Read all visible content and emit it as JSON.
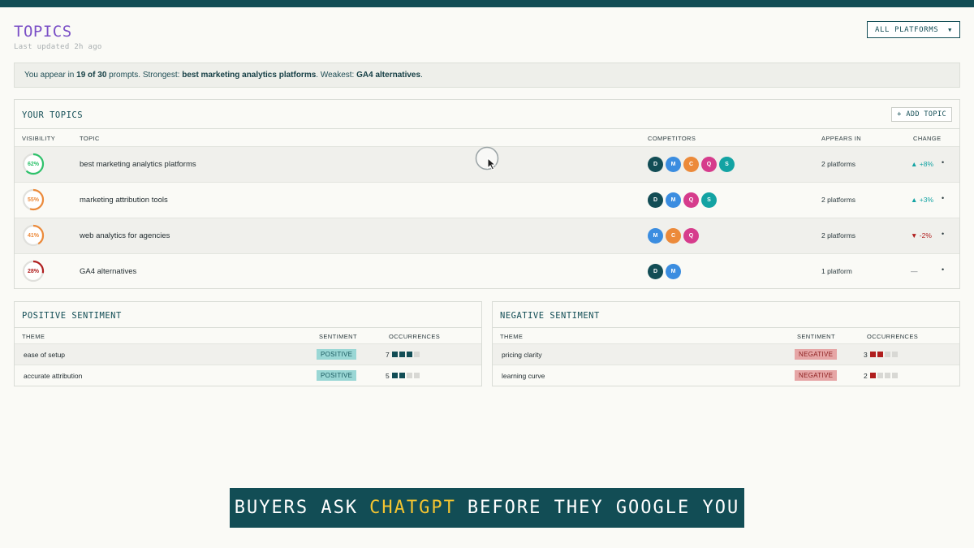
{
  "header": {
    "title": "TOPICS",
    "last_updated": "Last updated 2h ago",
    "platform_filter": "ALL PLATFORMS"
  },
  "summary": {
    "prefix": "You appear in ",
    "count": "19 of 30",
    "mid1": " prompts. Strongest: ",
    "strongest": "best marketing analytics platforms",
    "mid2": ". Weakest: ",
    "weakest": "GA4 alternatives",
    "suffix": "."
  },
  "topics": {
    "title": "YOUR TOPICS",
    "add_label": "+ ADD TOPIC",
    "columns": {
      "visibility": "VISIBILITY",
      "topic": "TOPIC",
      "competitors": "COMPETITORS",
      "appears_in": "APPEARS IN",
      "change": "CHANGE"
    },
    "rows": [
      {
        "visibility": 62,
        "visibility_label": "62%",
        "name": "best marketing analytics platforms",
        "appears": "2 platforms",
        "change": "▲ +8%",
        "trend": "up",
        "more": "•"
      },
      {
        "visibility": 55,
        "visibility_label": "55%",
        "name": "marketing attribution tools",
        "appears": "2 platforms",
        "change": "▲ +3%",
        "trend": "up",
        "more": "•"
      },
      {
        "visibility": 41,
        "visibility_label": "41%",
        "name": "web analytics for agencies",
        "appears": "2 platforms",
        "change": "▼ -2%",
        "trend": "down",
        "more": "•"
      },
      {
        "visibility": 28,
        "visibility_label": "28%",
        "name": "GA4 alternatives",
        "appears": "1 platform",
        "change": "—",
        "trend": "flat",
        "more": "•"
      }
    ],
    "competitors": [
      [
        "D",
        "M",
        "C",
        "Q",
        "S"
      ],
      [
        "D",
        "M",
        "Q",
        "S"
      ],
      [
        "M",
        "C",
        "Q"
      ],
      [
        "D",
        "M"
      ]
    ]
  },
  "competitor_colors": {
    "D": "#124d55",
    "M": "#3b8de0",
    "C": "#ec8a3a",
    "Q": "#d63c8c",
    "S": "#13a3a3"
  },
  "visibility_colors": {
    "high": "#2ec26b",
    "mid": "#ec8a3a",
    "low": "#b01e1e",
    "track": "#e0e0dc"
  },
  "positive": {
    "title": "POSITIVE SENTIMENT",
    "columns": {
      "theme": "THEME",
      "sentiment": "SENTIMENT",
      "occurrences": "OCCURRENCES"
    },
    "rows": [
      {
        "theme": "ease of setup",
        "sentiment": "POSITIVE",
        "occurrences": 7,
        "occ_label": "7",
        "filled": 3
      },
      {
        "theme": "accurate attribution",
        "sentiment": "POSITIVE",
        "occurrences": 5,
        "occ_label": "5",
        "filled": 2
      }
    ]
  },
  "negative": {
    "title": "NEGATIVE SENTIMENT",
    "columns": {
      "theme": "THEME",
      "sentiment": "SENTIMENT",
      "occurrences": "OCCURRENCES"
    },
    "rows": [
      {
        "theme": "pricing clarity",
        "sentiment": "NEGATIVE",
        "occurrences": 3,
        "occ_label": "3",
        "filled": 2
      },
      {
        "theme": "learning curve",
        "sentiment": "NEGATIVE",
        "occurrences": 2,
        "occ_label": "2",
        "filled": 1
      }
    ]
  },
  "banner": {
    "before": "BUYERS ASK",
    "highlight": "CHATGPT",
    "after": "BEFORE THEY GOOGLE YOU"
  }
}
